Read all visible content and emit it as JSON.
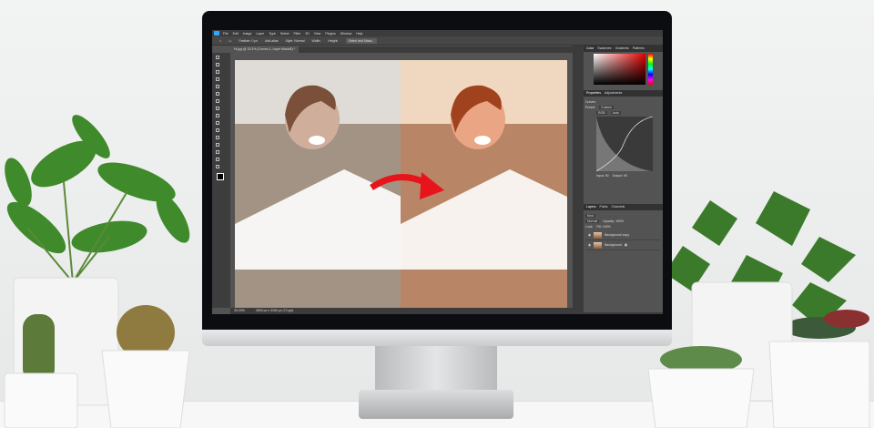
{
  "photoshop": {
    "menu": [
      "File",
      "Edit",
      "Image",
      "Layer",
      "Type",
      "Select",
      "Filter",
      "3D",
      "View",
      "Plugins",
      "Window",
      "Help"
    ],
    "options": {
      "feather": "Feather: 0 px",
      "anti_alias": "Anti-alias",
      "style": "Style: Normal",
      "width": "Width:",
      "height": "Height:",
      "select_mask": "Select and Mask..."
    },
    "document_tab": "Hi.jpg @ 33.3% (Curves 1, Layer Mask/8) *",
    "status": {
      "zoom": "33.33%",
      "doc": "4500 px x 3150 px (72 ppi)"
    },
    "color_panel": {
      "tabs": [
        "Color",
        "Swatches",
        "Gradients",
        "Patterns"
      ]
    },
    "properties_panel": {
      "tabs": [
        "Properties",
        "Adjustments"
      ],
      "title": "Curves",
      "preset_label": "Preset:",
      "preset": "Custom",
      "channel": "RGB",
      "auto": "Auto",
      "input": "Input: 90",
      "output": "Output: 90"
    },
    "layers_panel": {
      "tabs": [
        "Layers",
        "Paths",
        "Channels"
      ],
      "kind": "Kind",
      "blend": "Normal",
      "opacity": "Opacity: 100%",
      "lock": "Lock:",
      "fill": "Fill: 100%",
      "layers": [
        "Background copy",
        "Background"
      ]
    }
  },
  "colors": {
    "accent": "#31a8ff",
    "arrow": "#e8141b"
  }
}
